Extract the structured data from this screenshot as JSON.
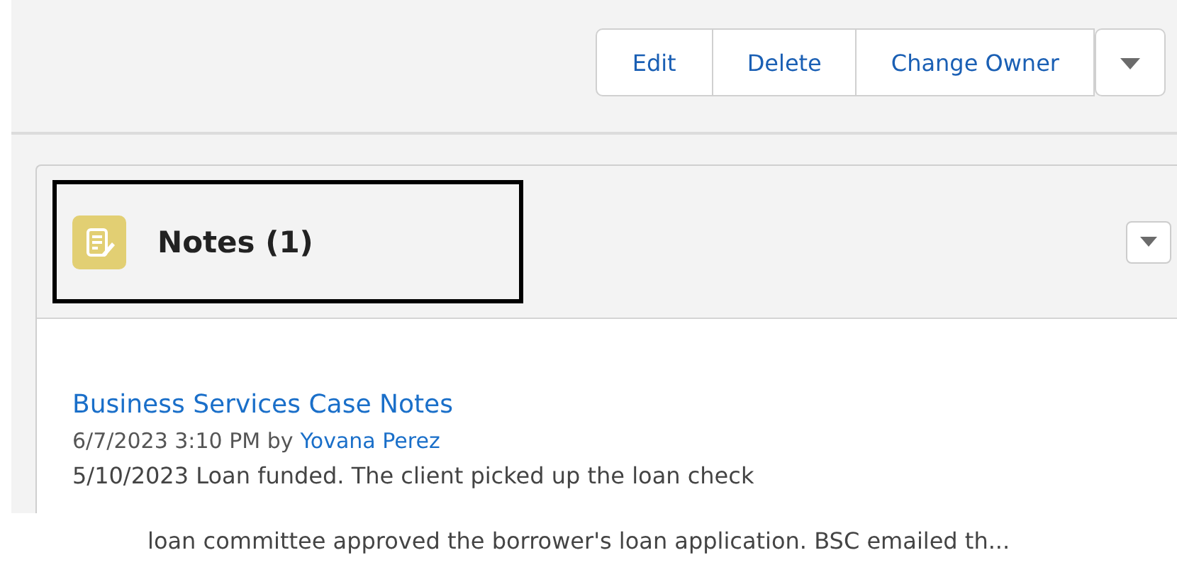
{
  "actions": [
    "Edit",
    "Delete",
    "Change Owner"
  ],
  "notes_card": {
    "title": "Notes (1)",
    "highlighted": true,
    "note": {
      "title": "Business Services Case Notes",
      "date": "6/7/2023 3:10 PM",
      "by": "by",
      "author": "Yovana Perez",
      "body_lines": [
        "5/10/2023 Loan funded. The client picked up the loan check",
        "loan committee approved the borrower's loan application. BSC emailed th..."
      ]
    }
  }
}
